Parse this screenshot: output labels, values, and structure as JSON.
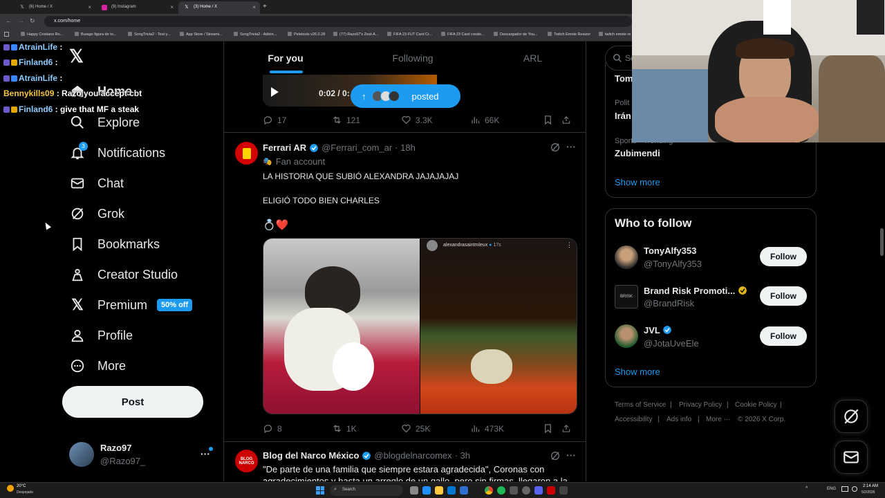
{
  "browser": {
    "tabs": [
      {
        "label": "(6) Home / X"
      },
      {
        "label": "(9) Instagram"
      },
      {
        "label": "(3) Home / X"
      }
    ],
    "url": "x.com/home",
    "bookmarks": [
      "Happy Cristiano Ro...",
      "Burago figura de to...",
      "SongTrivia2 - Test y...",
      "App Store / Streami...",
      "SongTrivia2 - Adivin...",
      "Peletools v26.0.28",
      "(77) Razo97's Zest-A...",
      "FIFA 23 FUT Card Cr...",
      "FIFA 23 Card creato...",
      "Descargador de You...",
      "Twitch Emote Resizer",
      "twitch emote re"
    ]
  },
  "chat_overlay": [
    {
      "user": "AtrainLife",
      "msg": ""
    },
    {
      "user": "Finland6",
      "msg": ""
    },
    {
      "user": "AtrainLife",
      "msg": ""
    },
    {
      "user": "Bennykills09",
      "msg": "Razo you accept cbt"
    },
    {
      "user": "Finland6",
      "msg": "give that MF a steak"
    }
  ],
  "nav": {
    "home_label": "Home",
    "items": [
      {
        "label": "Explore"
      },
      {
        "label": "Notifications",
        "badge": "3"
      },
      {
        "label": "Chat"
      },
      {
        "label": "Grok"
      },
      {
        "label": "Bookmarks"
      },
      {
        "label": "Creator Studio"
      },
      {
        "label": "Premium",
        "badge": "50% off"
      },
      {
        "label": "Profile"
      },
      {
        "label": "More"
      }
    ],
    "post_label": "Post",
    "account": {
      "name": "Razo97",
      "handle": "@Razo97_"
    }
  },
  "feed": {
    "tabs": [
      "For you",
      "Following",
      "ARL"
    ],
    "video_time": "0:02 / 0:",
    "posted_pill": "posted",
    "post1_stats": {
      "replies": "17",
      "reposts": "121",
      "likes": "3.3K",
      "views": "66K"
    },
    "post2": {
      "name": "Ferrari AR",
      "handle": "@Ferrari_com_ar",
      "time": "· 18h",
      "badge": "Fan account",
      "line1": "LA HISTORIA QUE SUBIÓ ALEXANDRA JAJAJAJAJ",
      "line2": "ELIGIÓ TODO BIEN CHARLES",
      "emojis": "💍❤️",
      "story_user": "alexandrasaintmleux",
      "story_time": "17s",
      "stats": {
        "replies": "8",
        "reposts": "1K",
        "likes": "25K",
        "views": "473K"
      }
    },
    "post3": {
      "name": "Blog del Narco México",
      "handle": "@blogdelnarcomex",
      "time": "· 3h",
      "line1": "\"De parte de una familia que siempre estara agradecida\", Coronas con",
      "line2": "agradecimientos y hasta un arreglo de un gallo, pero sin firmas, llegaron a la"
    }
  },
  "right": {
    "search_placeholder": "Se",
    "trends": [
      {
        "category": "",
        "name": "Tom"
      },
      {
        "category": "Polit",
        "name": "Irán"
      },
      {
        "category": "Sports · Trending",
        "name": "Zubimendi"
      }
    ],
    "show_more": "Show more",
    "wtf_title": "Who to follow",
    "wtf": [
      {
        "name": "TonyAlfy353",
        "handle": "@TonyAlfy353",
        "verified": false
      },
      {
        "name": "Brand Risk Promoti...",
        "handle": "@BrandRisk",
        "verified": "gold"
      },
      {
        "name": "JVL",
        "handle": "@JotaUveEle",
        "verified": "blue"
      }
    ],
    "follow_label": "Follow",
    "footer": [
      "Terms of Service",
      "|",
      "Privacy Policy",
      "|",
      "Cookie Policy",
      "|",
      "Accessibility",
      "|",
      "Ads info",
      "|",
      "More ···",
      "© 2026 X Corp."
    ]
  },
  "taskbar": {
    "weather_temp": "20°C",
    "weather_desc": "Despejado",
    "search_label": "Search",
    "lang": "ENG",
    "time": "2:14 AM",
    "date": "5/2/2026"
  },
  "colors": {
    "accent": "#1d9bf0",
    "bg": "#000000",
    "border": "#2f3336",
    "muted": "#71767b"
  }
}
